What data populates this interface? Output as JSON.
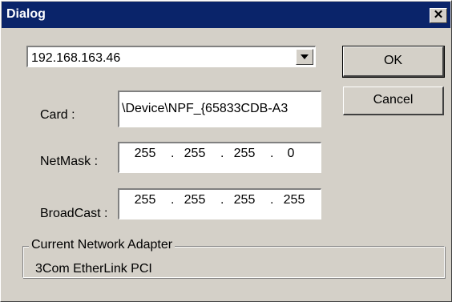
{
  "window": {
    "title": "Dialog",
    "close_glyph": "✕",
    "close_icon": "close-icon"
  },
  "adapter_select": {
    "selected": "192.168.163.46",
    "arrow_icon": "chevron-down-icon"
  },
  "buttons": {
    "ok_label": "OK",
    "cancel_label": "Cancel"
  },
  "fields": {
    "card_label": "Card :",
    "card_value": "\\Device\\NPF_{65833CDB-A3",
    "netmask_label": "NetMask :",
    "netmask": [
      "255",
      "255",
      "255",
      "0"
    ],
    "broadcast_label": "BroadCast :",
    "broadcast": [
      "255",
      "255",
      "255",
      "255"
    ],
    "separator": "."
  },
  "current_adapter": {
    "legend": "Current Network Adapter",
    "value": "3Com EtherLink PCI"
  },
  "colors": {
    "face": "#d4d0c8",
    "titlebar": "#0a246a",
    "field_bg": "#ffffff"
  }
}
